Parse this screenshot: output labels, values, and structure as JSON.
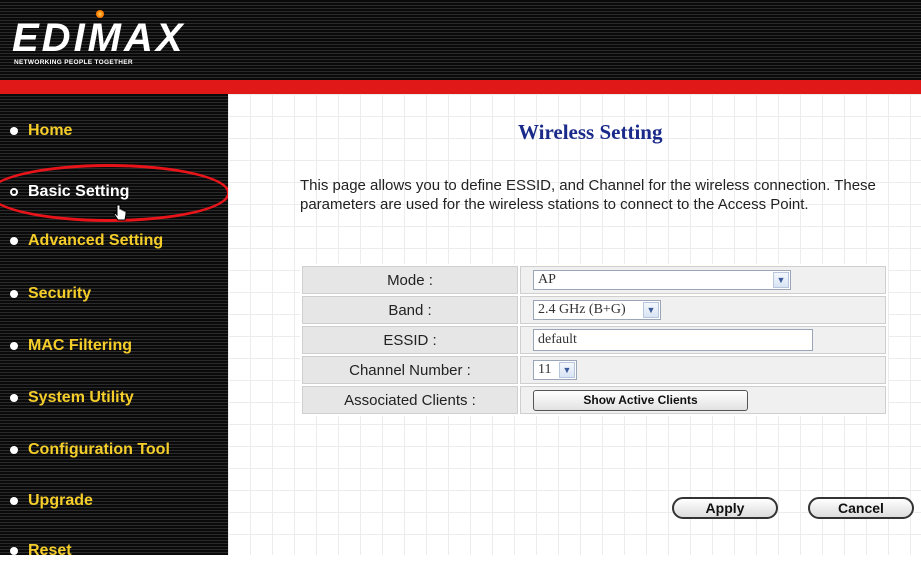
{
  "header": {
    "logo_text": "EDIMAX",
    "tagline": "NETWORKING PEOPLE TOGETHER"
  },
  "sidebar": {
    "items": [
      {
        "label": "Home"
      },
      {
        "label": "Basic Setting",
        "active": true
      },
      {
        "label": "Advanced Setting"
      },
      {
        "label": "Security"
      },
      {
        "label": "MAC Filtering"
      },
      {
        "label": "System Utility"
      },
      {
        "label": "Configuration Tool"
      },
      {
        "label": "Upgrade"
      },
      {
        "label": "Reset"
      }
    ]
  },
  "main": {
    "title": "Wireless Setting",
    "description": "This page allows you to define ESSID, and Channel for the wireless connection. These parameters are used for the wireless stations to connect to the Access Point.",
    "form": {
      "mode_label": "Mode :",
      "mode_value": "AP",
      "band_label": "Band :",
      "band_value": "2.4 GHz (B+G)",
      "essid_label": "ESSID :",
      "essid_value": "default",
      "channel_label": "Channel Number :",
      "channel_value": "11",
      "clients_label": "Associated Clients :",
      "clients_button": "Show Active Clients"
    },
    "apply_button": "Apply",
    "cancel_button": "Cancel"
  },
  "colors": {
    "nav_text": "#f5ce2a",
    "brand_red": "#e01818",
    "title_blue": "#1a2a8a"
  }
}
